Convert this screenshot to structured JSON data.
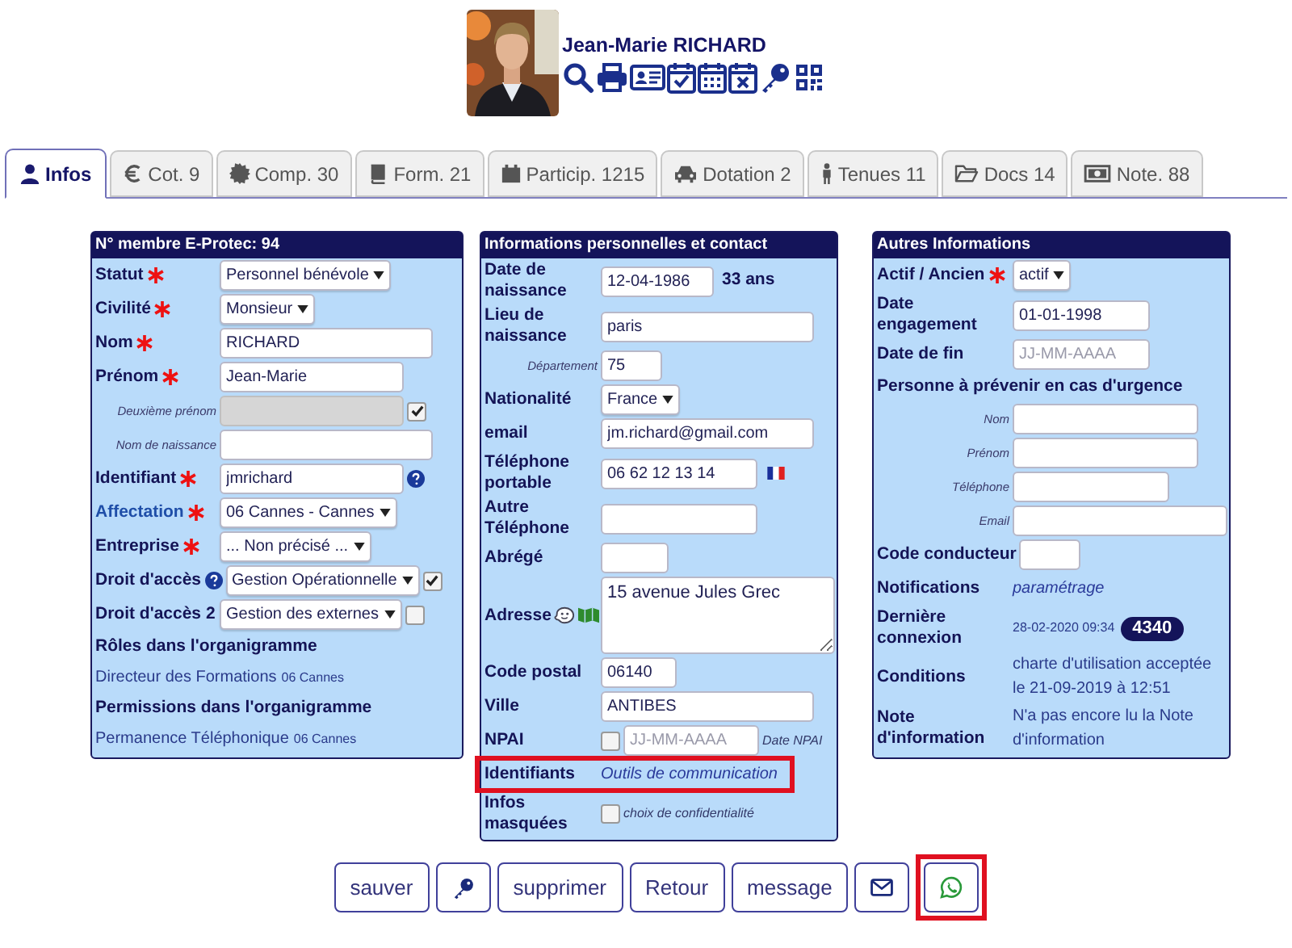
{
  "member": {
    "name": "Jean-Marie RICHARD"
  },
  "tabs": [
    {
      "label": "Infos",
      "selected": true
    },
    {
      "label": "Cot. 9",
      "selected": false
    },
    {
      "label": "Comp. 30",
      "selected": false
    },
    {
      "label": "Form. 21",
      "selected": false
    },
    {
      "label": "Particip. 1215",
      "selected": false
    },
    {
      "label": "Dotation 2",
      "selected": false
    },
    {
      "label": "Tenues 11",
      "selected": false
    },
    {
      "label": "Docs 14",
      "selected": false
    },
    {
      "label": "Note. 88",
      "selected": false
    }
  ],
  "panels": [
    {
      "title": "N° membre E-Protec: 94",
      "rows": [
        {
          "kind": "field",
          "label": {
            "kind": "bold",
            "text": "Statut"
          },
          "required": true,
          "highlighted": false,
          "control": {
            "kind": "select",
            "value": "Personnel bénévole"
          }
        },
        {
          "kind": "field",
          "label": {
            "kind": "bold",
            "text": "Civilité"
          },
          "required": true,
          "highlighted": false,
          "control": {
            "kind": "select",
            "value": "Monsieur"
          }
        },
        {
          "kind": "field",
          "label": {
            "kind": "bold",
            "text": "Nom"
          },
          "required": true,
          "highlighted": false,
          "control": {
            "kind": "input",
            "value": "RICHARD"
          }
        },
        {
          "kind": "field",
          "label": {
            "kind": "bold",
            "text": "Prénom"
          },
          "required": true,
          "highlighted": false,
          "control": {
            "kind": "input",
            "value": "Jean-Marie"
          }
        },
        {
          "kind": "field",
          "label": {
            "kind": "small",
            "text": "Deuxième prénom"
          },
          "required": false,
          "highlighted": false,
          "control": {
            "kind": "input",
            "disabled": true
          },
          "after": [
            {
              "kind": "checkbox",
              "checked": true
            }
          ]
        },
        {
          "kind": "field",
          "label": {
            "kind": "small",
            "text": "Nom de naissance"
          },
          "required": false,
          "highlighted": false,
          "control": {
            "kind": "input"
          }
        },
        {
          "kind": "field",
          "label": {
            "kind": "bold",
            "text": "Identifiant"
          },
          "required": true,
          "highlighted": false,
          "control": {
            "kind": "input",
            "value": "jmrichard"
          },
          "after": [
            {
              "kind": "help"
            }
          ]
        },
        {
          "kind": "field",
          "label": {
            "kind": "link",
            "text": "Affectation"
          },
          "required": true,
          "highlighted": false,
          "control": {
            "kind": "select",
            "value": "06 Cannes - Cannes"
          }
        },
        {
          "kind": "field",
          "label": {
            "kind": "bold",
            "text": "Entreprise"
          },
          "required": true,
          "highlighted": false,
          "control": {
            "kind": "select",
            "value": "... Non précisé ..."
          }
        },
        {
          "kind": "field",
          "label": {
            "kind": "bold",
            "text": "Droit d'accès"
          },
          "label_icons": [
            {
              "kind": "help"
            }
          ],
          "required": false,
          "highlighted": false,
          "control": {
            "kind": "select",
            "value": "Gestion Opérationnelle"
          },
          "after": [
            {
              "kind": "checkbox",
              "checked": true
            }
          ]
        },
        {
          "kind": "field",
          "label": {
            "kind": "bold",
            "text": "Droit d'accès 2"
          },
          "required": false,
          "highlighted": false,
          "control": {
            "kind": "select",
            "value": "Gestion des externes"
          },
          "after": [
            {
              "kind": "checkbox",
              "checked": false
            }
          ]
        },
        {
          "kind": "heading",
          "text": "Rôles dans l'organigramme"
        },
        {
          "kind": "line",
          "text": "Directeur des Formations",
          "note": "06 Cannes"
        },
        {
          "kind": "heading",
          "text": "Permissions dans l'organigramme"
        },
        {
          "kind": "line",
          "text": "Permanence Téléphonique",
          "note": "06 Cannes"
        }
      ]
    },
    {
      "title": "Informations personnelles et contact",
      "rows": [
        {
          "kind": "field",
          "label": {
            "kind": "bold",
            "text": "Date de naissance"
          },
          "required": false,
          "highlighted": false,
          "control": {
            "kind": "input",
            "value": "12-04-1986"
          },
          "after": [
            {
              "kind": "bold",
              "text": "33 ans"
            }
          ]
        },
        {
          "kind": "field",
          "label": {
            "kind": "bold",
            "text": "Lieu de naissance"
          },
          "required": false,
          "highlighted": false,
          "control": {
            "kind": "input",
            "value": "paris"
          }
        },
        {
          "kind": "field",
          "label": {
            "kind": "small",
            "text": "Département"
          },
          "required": false,
          "highlighted": false,
          "control": {
            "kind": "input",
            "value": "75"
          }
        },
        {
          "kind": "field",
          "label": {
            "kind": "bold",
            "text": "Nationalité"
          },
          "required": false,
          "highlighted": false,
          "control": {
            "kind": "select",
            "value": "France"
          }
        },
        {
          "kind": "field",
          "label": {
            "kind": "bold",
            "text": "email"
          },
          "required": false,
          "highlighted": false,
          "control": {
            "kind": "input",
            "value": "jm.richard@gmail.com"
          }
        },
        {
          "kind": "field",
          "label": {
            "kind": "bold",
            "text": "Téléphone portable"
          },
          "required": false,
          "highlighted": false,
          "control": {
            "kind": "input",
            "value": "06 62 12 13 14"
          },
          "after": [
            {
              "kind": "flag"
            }
          ]
        },
        {
          "kind": "field",
          "label": {
            "kind": "bold",
            "text": "Autre Téléphone"
          },
          "required": false,
          "highlighted": false,
          "control": {
            "kind": "input"
          }
        },
        {
          "kind": "field",
          "label": {
            "kind": "bold",
            "text": "Abrégé"
          },
          "required": false,
          "highlighted": false,
          "control": {
            "kind": "input"
          }
        },
        {
          "kind": "field",
          "label": {
            "kind": "bold",
            "text": "Adresse"
          },
          "label_icons": [
            {
              "kind": "smiley"
            },
            {
              "kind": "map"
            }
          ],
          "required": false,
          "highlighted": false,
          "control": {
            "kind": "textarea",
            "value": "15 avenue Jules Grec"
          }
        },
        {
          "kind": "field",
          "label": {
            "kind": "bold",
            "text": "Code postal"
          },
          "required": false,
          "highlighted": false,
          "control": {
            "kind": "input",
            "value": "06140"
          }
        },
        {
          "kind": "field",
          "label": {
            "kind": "bold",
            "text": "Ville"
          },
          "required": false,
          "highlighted": false,
          "control": {
            "kind": "input",
            "value": "ANTIBES"
          }
        },
        {
          "kind": "field",
          "label": {
            "kind": "bold",
            "text": "NPAI"
          },
          "required": false,
          "highlighted": false,
          "control": {
            "kind": "checkbox",
            "checked": false
          },
          "after": [
            {
              "kind": "input",
              "placeholder": "JJ-MM-AAAA"
            },
            {
              "kind": "note",
              "text": "Date NPAI"
            }
          ]
        },
        {
          "kind": "field",
          "label": {
            "kind": "bold",
            "text": "Identifiants"
          },
          "required": false,
          "highlighted": true,
          "control": {
            "kind": "link",
            "text": "Outils de communication"
          }
        },
        {
          "kind": "field",
          "label": {
            "kind": "bold",
            "text": "Infos masquées"
          },
          "required": false,
          "highlighted": false,
          "control": {
            "kind": "checkbox",
            "checked": false
          },
          "after": [
            {
              "kind": "note",
              "text": "choix de confidentialité"
            }
          ]
        }
      ]
    },
    {
      "title": "Autres Informations",
      "rows": [
        {
          "kind": "field",
          "label": {
            "kind": "bold",
            "text": "Actif / Ancien"
          },
          "required": true,
          "highlighted": false,
          "control": {
            "kind": "select",
            "value": "actif"
          }
        },
        {
          "kind": "field",
          "label": {
            "kind": "bold",
            "text": "Date engagement"
          },
          "required": false,
          "highlighted": false,
          "control": {
            "kind": "input",
            "value": "01-01-1998"
          }
        },
        {
          "kind": "field",
          "label": {
            "kind": "bold",
            "text": "Date de fin"
          },
          "required": false,
          "highlighted": false,
          "control": {
            "kind": "input",
            "placeholder": "JJ-MM-AAAA"
          }
        },
        {
          "kind": "heading",
          "text": "Personne à prévenir en cas d'urgence"
        },
        {
          "kind": "field",
          "label": {
            "kind": "small",
            "text": "Nom"
          },
          "required": false,
          "highlighted": false,
          "control": {
            "kind": "input"
          }
        },
        {
          "kind": "field",
          "label": {
            "kind": "small",
            "text": "Prénom"
          },
          "required": false,
          "highlighted": false,
          "control": {
            "kind": "input"
          }
        },
        {
          "kind": "field",
          "label": {
            "kind": "small",
            "text": "Téléphone"
          },
          "required": false,
          "highlighted": false,
          "control": {
            "kind": "input"
          }
        },
        {
          "kind": "field",
          "label": {
            "kind": "small",
            "text": "Email"
          },
          "required": false,
          "highlighted": false,
          "control": {
            "kind": "input"
          }
        },
        {
          "kind": "field",
          "label": {
            "kind": "bold",
            "text": "Code conducteur"
          },
          "required": false,
          "highlighted": false,
          "control": {
            "kind": "input"
          }
        },
        {
          "kind": "field",
          "label": {
            "kind": "bold",
            "text": "Notifications"
          },
          "required": false,
          "highlighted": false,
          "control": {
            "kind": "link",
            "text": "paramétrage"
          }
        },
        {
          "kind": "field",
          "label": {
            "kind": "bold",
            "text": "Dernière connexion"
          },
          "required": false,
          "highlighted": false,
          "control": {
            "kind": "note",
            "text": "28-02-2020 09:34"
          },
          "after": [
            {
              "kind": "badge",
              "text": "4340"
            }
          ]
        },
        {
          "kind": "field",
          "label": {
            "kind": "bold",
            "text": "Conditions"
          },
          "required": false,
          "highlighted": false,
          "control": {
            "kind": "text",
            "text": "charte d'utilisation acceptée le 21-09-2019 à 12:51"
          }
        },
        {
          "kind": "field",
          "label": {
            "kind": "bold",
            "text": "Note d'information"
          },
          "required": false,
          "highlighted": false,
          "control": {
            "kind": "text",
            "text": "N'a pas encore lu la Note d'information"
          }
        }
      ]
    }
  ],
  "buttons": [
    {
      "kind": "text",
      "label": "sauver",
      "highlighted": false
    },
    {
      "kind": "key",
      "highlighted": false
    },
    {
      "kind": "text",
      "label": "supprimer",
      "highlighted": false
    },
    {
      "kind": "text",
      "label": "Retour",
      "highlighted": false
    },
    {
      "kind": "text",
      "label": "message",
      "highlighted": false
    },
    {
      "kind": "mail",
      "highlighted": false
    },
    {
      "kind": "chat",
      "highlighted": true
    }
  ]
}
